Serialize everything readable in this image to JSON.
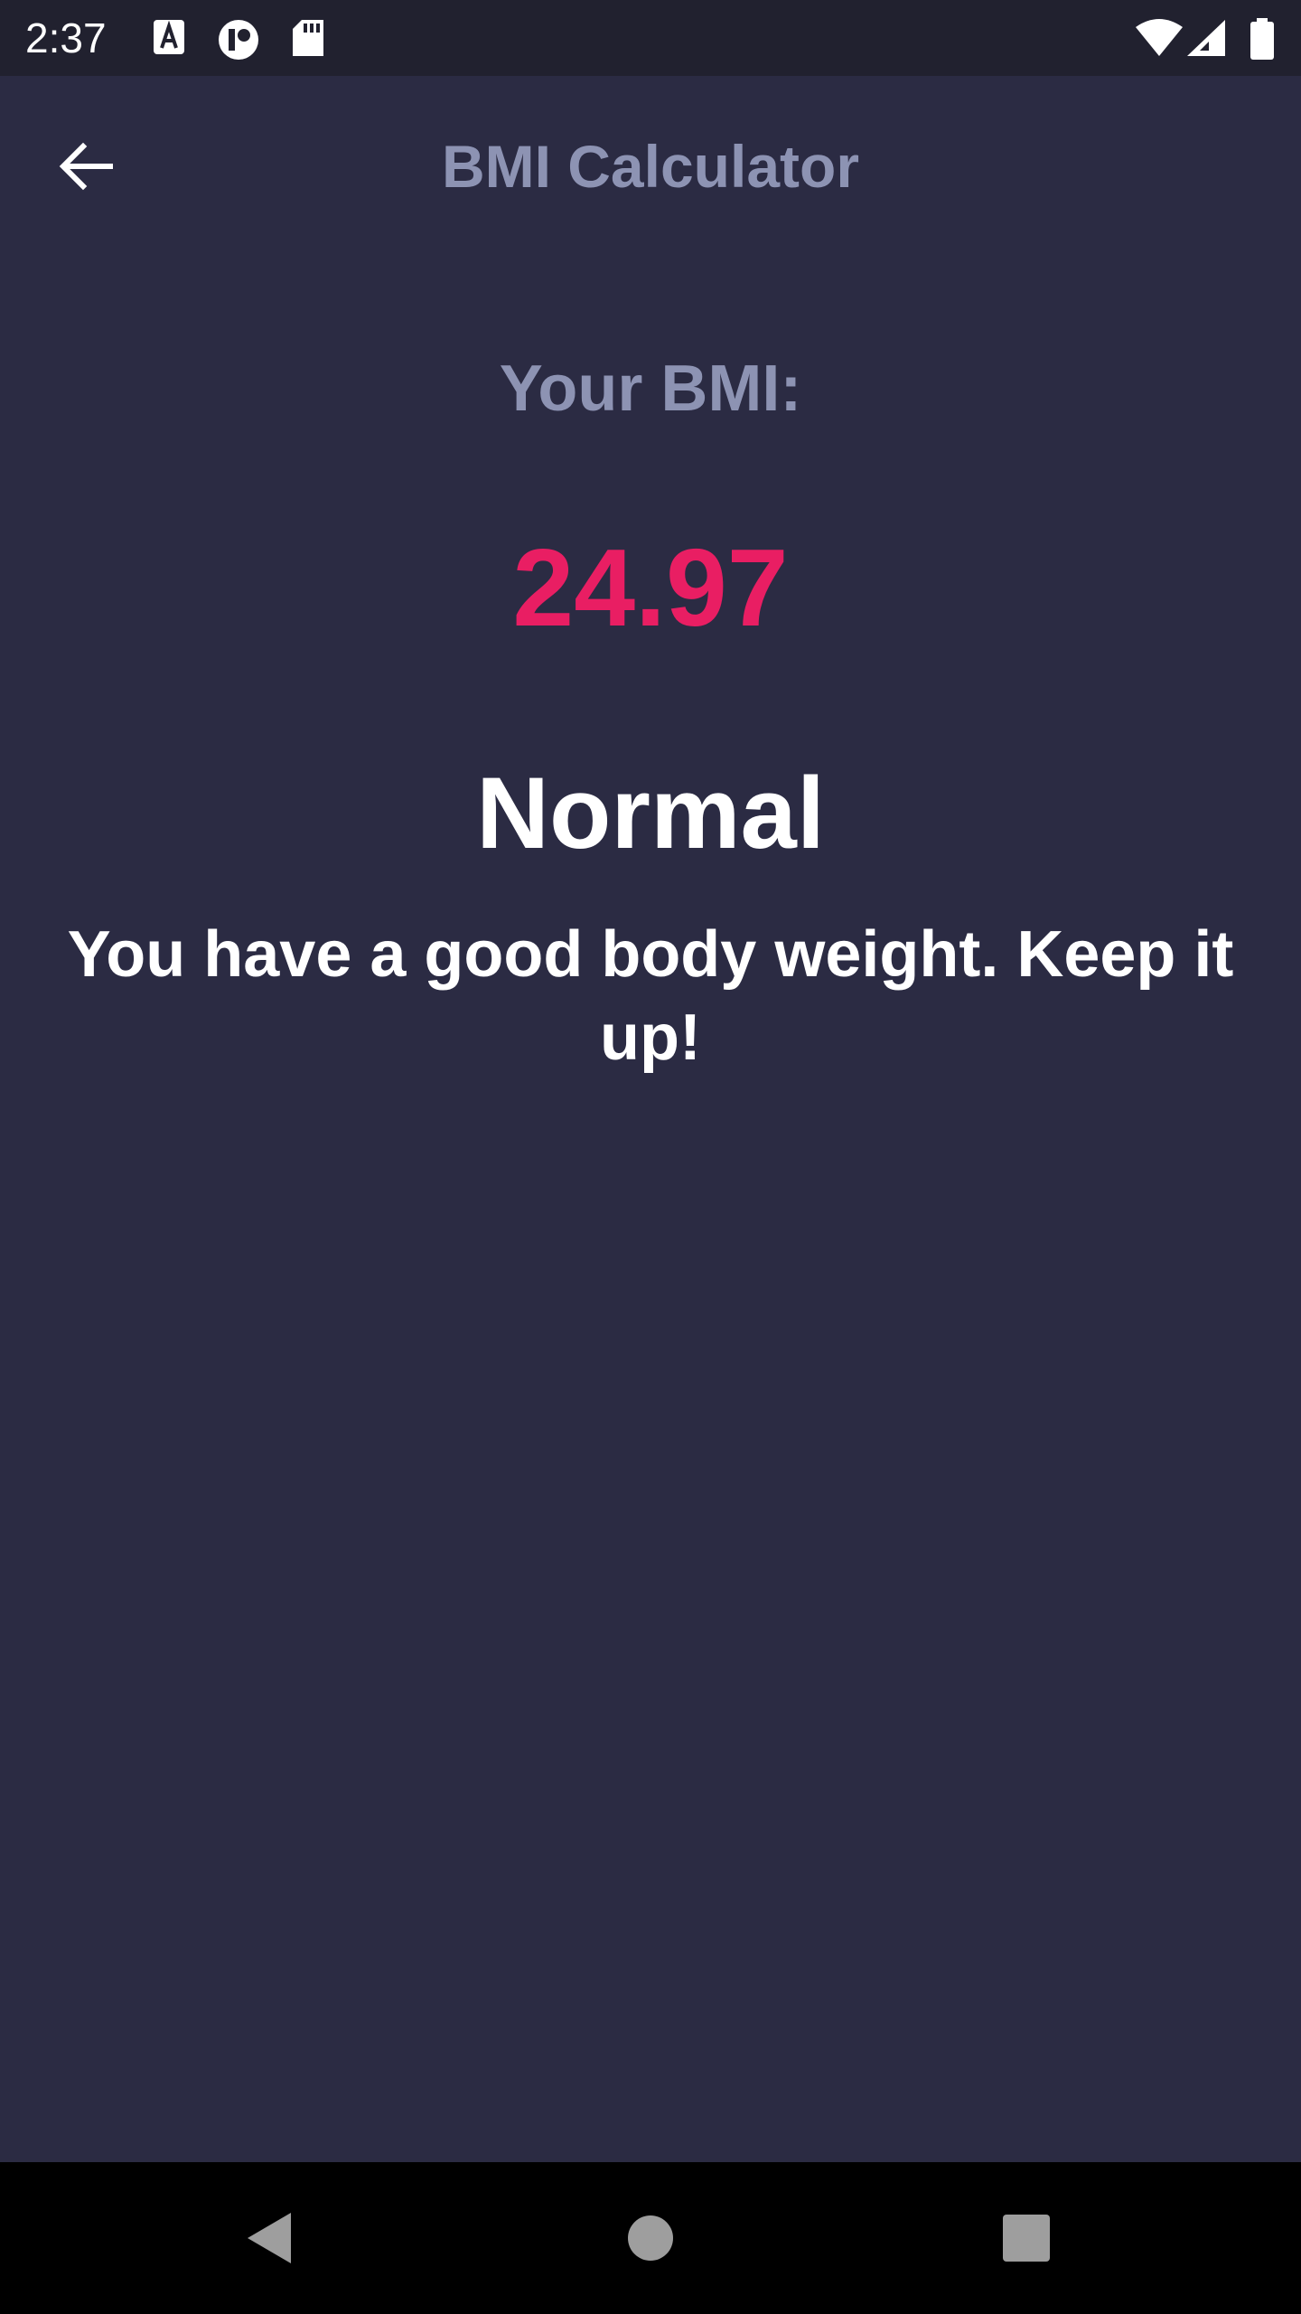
{
  "status_bar": {
    "time": "2:37",
    "left_icons": [
      "text-a-icon",
      "circle-p-icon",
      "sd-card-icon"
    ],
    "right_icons": [
      "wifi-icon",
      "cell-signal-icon",
      "battery-icon"
    ]
  },
  "app_bar": {
    "title": "BMI Calculator",
    "back_icon": "arrow-back-icon"
  },
  "result": {
    "label": "Your BMI:",
    "value": "24.97",
    "category": "Normal",
    "advice": "You have a good body weight. Keep it up!"
  },
  "nav_bar": {
    "icons": [
      "back-triangle-icon",
      "home-circle-icon",
      "recents-square-icon"
    ]
  },
  "colors": {
    "background": "#2b2b43",
    "status_bar": "#21212f",
    "title_muted": "#8d93b3",
    "bmi_accent": "#e91e63",
    "text_primary": "#ffffff",
    "nav_bar": "#000000"
  }
}
